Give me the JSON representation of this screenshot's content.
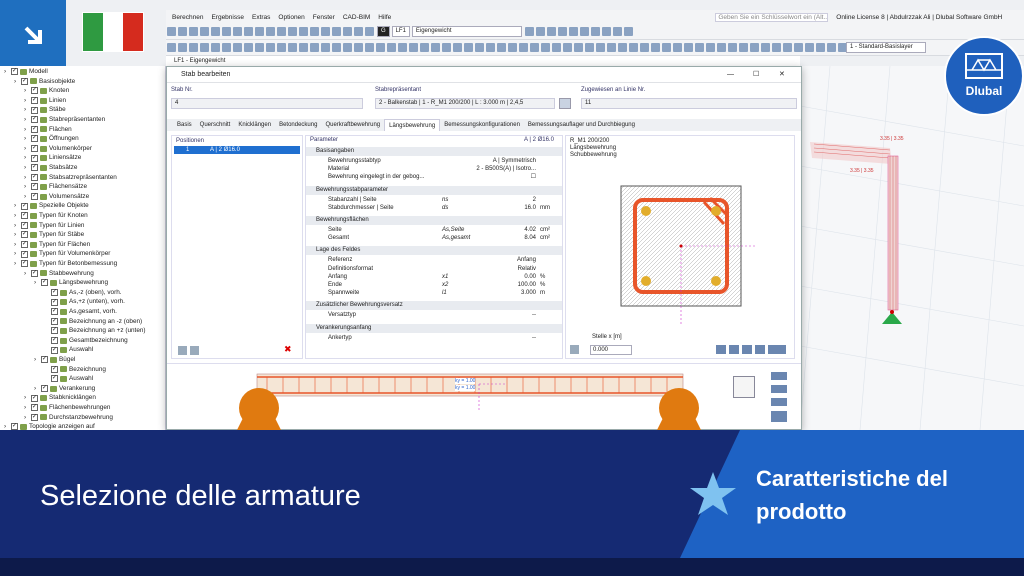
{
  "menu": [
    "Berechnen",
    "Ergebnisse",
    "Extras",
    "Optionen",
    "Fenster",
    "CAD-BIM",
    "Hilfe"
  ],
  "search_placeholder": "Geben Sie ein Schlüsselwort ein (Alt...",
  "license": "Online License 8 | Abdulrzzak Ali | Dlubal Software GmbH",
  "toolbar": {
    "lc_code": "G",
    "lc_id": "LF1",
    "lc_name": "Eigengewicht",
    "layer": "1 - Standard-Basislayer"
  },
  "viewport_header": "LF1 - Eigengewicht",
  "viewport_labels": [
    "3.35 | 3.35",
    "3.35 | 3.35"
  ],
  "tree": [
    {
      "label": "Modell",
      "lvl": 0
    },
    {
      "label": "Basisobjekte",
      "lvl": 1
    },
    {
      "label": "Knoten",
      "lvl": 2
    },
    {
      "label": "Linien",
      "lvl": 2
    },
    {
      "label": "Stäbe",
      "lvl": 2
    },
    {
      "label": "Stabrepräsentanten",
      "lvl": 2
    },
    {
      "label": "Flächen",
      "lvl": 2
    },
    {
      "label": "Öffnungen",
      "lvl": 2
    },
    {
      "label": "Volumenkörper",
      "lvl": 2
    },
    {
      "label": "Liniensätze",
      "lvl": 2
    },
    {
      "label": "Stabsätze",
      "lvl": 2
    },
    {
      "label": "Stabsatzrepräsentanten",
      "lvl": 2
    },
    {
      "label": "Flächensätze",
      "lvl": 2
    },
    {
      "label": "Volumensätze",
      "lvl": 2
    },
    {
      "label": "Spezielle Objekte",
      "lvl": 1
    },
    {
      "label": "Typen für Knoten",
      "lvl": 1
    },
    {
      "label": "Typen für Linien",
      "lvl": 1
    },
    {
      "label": "Typen für Stäbe",
      "lvl": 1
    },
    {
      "label": "Typen für Flächen",
      "lvl": 1
    },
    {
      "label": "Typen für Volumenkörper",
      "lvl": 1
    },
    {
      "label": "Typen für Betonbemessung",
      "lvl": 1
    },
    {
      "label": "Stabbewehrung",
      "lvl": 2
    },
    {
      "label": "Längsbewehrung",
      "lvl": 3
    },
    {
      "label": "As,-z (oben), vorh.",
      "lvl": 4
    },
    {
      "label": "As,+z (unten), vorh.",
      "lvl": 4
    },
    {
      "label": "As,gesamt, vorh.",
      "lvl": 4
    },
    {
      "label": "Bezeichnung an -z (oben)",
      "lvl": 4
    },
    {
      "label": "Bezeichnung an +z (unten)",
      "lvl": 4
    },
    {
      "label": "Gesamtbezeichnung",
      "lvl": 4
    },
    {
      "label": "Auswahl",
      "lvl": 4
    },
    {
      "label": "Bügel",
      "lvl": 3
    },
    {
      "label": "Bezeichnung",
      "lvl": 4
    },
    {
      "label": "Auswahl",
      "lvl": 4
    },
    {
      "label": "Verankerung",
      "lvl": 3
    },
    {
      "label": "Stabknicklängen",
      "lvl": 2
    },
    {
      "label": "Flächenbewehrungen",
      "lvl": 2
    },
    {
      "label": "Durchstanzbewehrung",
      "lvl": 2
    },
    {
      "label": "Topologie anzeigen auf",
      "lvl": 0
    }
  ],
  "dialog": {
    "title": "Stab bearbeiten",
    "stab_nr_label": "Stab Nr.",
    "stab_nr": "4",
    "rep_label": "Stabrepräsentant",
    "rep": "2 - Balkenstab | 1 - R_M1 200/200 | L : 3.000 m | 2,4,5",
    "assigned_label": "Zugewiesen an Linie Nr.",
    "assigned": "11",
    "tabs": [
      "Basis",
      "Querschnitt",
      "Knicklängen",
      "Betondeckung",
      "Querkraftbewehrung",
      "Längsbewehrung",
      "Bemessungskonfigurationen",
      "Bemessungsauflager und Durchbiegung"
    ],
    "active_tab": "Längsbewehrung",
    "positions_label": "Positionen",
    "positions": [
      {
        "no": "1",
        "val": "A | 2 Ø16.0"
      }
    ],
    "params_label": "Parameter",
    "params_ref": "A | 2 Ø16.0",
    "sections": [
      {
        "title": "Basisangaben",
        "rows": [
          {
            "n": "Bewehrungsstabtyp",
            "s": "",
            "v": "A | Symmetrisch",
            "u": ""
          },
          {
            "n": "Material",
            "s": "",
            "v": "2 - B500S(A) | Isotro...",
            "u": ""
          },
          {
            "n": "Bewehrung eingelegt in der gebog...",
            "s": "",
            "v": "☐",
            "u": ""
          }
        ]
      },
      {
        "title": "Bewehrungsstabparameter",
        "rows": [
          {
            "n": "Stabanzahl | Seite",
            "s": "ns",
            "v": "2",
            "u": ""
          },
          {
            "n": "Stabdurchmesser | Seite",
            "s": "ds",
            "v": "16.0",
            "u": "mm"
          }
        ]
      },
      {
        "title": "Bewehrungsflächen",
        "rows": [
          {
            "n": "Seite",
            "s": "As,Seite",
            "v": "4.02",
            "u": "cm²"
          },
          {
            "n": "Gesamt",
            "s": "As,gesamt",
            "v": "8.04",
            "u": "cm²"
          }
        ]
      },
      {
        "title": "Lage des Feldes",
        "rows": [
          {
            "n": "Referenz",
            "s": "",
            "v": "Anfang",
            "u": ""
          },
          {
            "n": "Definitionsformat",
            "s": "",
            "v": "Relativ",
            "u": ""
          },
          {
            "n": "Anfang",
            "s": "x1",
            "v": "0.00",
            "u": "%"
          },
          {
            "n": "Ende",
            "s": "x2",
            "v": "100.00",
            "u": "%"
          },
          {
            "n": "Spannweite",
            "s": "l1",
            "v": "3.000",
            "u": "m"
          }
        ]
      },
      {
        "title": "Zusätzlicher Bewehrungsversatz",
        "rows": [
          {
            "n": "Versatztyp",
            "s": "",
            "v": "--",
            "u": ""
          }
        ]
      },
      {
        "title": "Verankerungsanfang",
        "rows": [
          {
            "n": "Ankertyp",
            "s": "",
            "v": "--",
            "u": ""
          }
        ]
      }
    ],
    "preview": {
      "line1": "R_M1 200/200",
      "line2": "Längsbewehrung",
      "line3": "Schubbewehrung",
      "station_label": "Stelle x [m]",
      "station": "0.000"
    },
    "beam_labels": [
      "ky = 1.00",
      "ky = 1.00"
    ]
  },
  "banner": {
    "title": "Selezione delle armature",
    "subtitle": "Caratteristiche del prodotto",
    "logo": "Dlubal"
  },
  "colors": {
    "banner": "#152a73",
    "accent": "#1e62c4",
    "rebar": "#e8552a",
    "flag_green": "#2f9a41",
    "flag_red": "#d52b1e"
  }
}
